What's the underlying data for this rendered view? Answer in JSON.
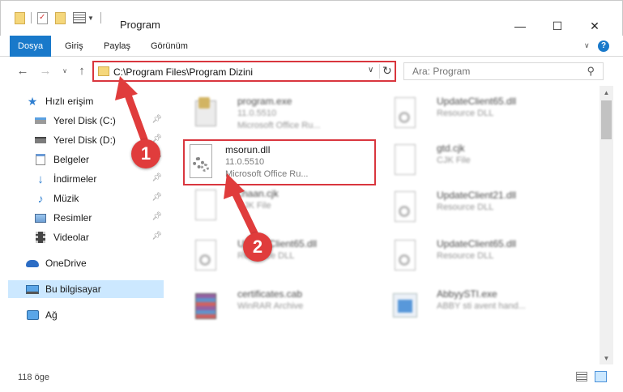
{
  "window": {
    "title": "Program",
    "minimize_glyph": "—",
    "maximize_glyph": "☐",
    "close_glyph": "✕"
  },
  "ribbon": {
    "tabs": [
      {
        "label": "Dosya",
        "active": true
      },
      {
        "label": "Giriş",
        "active": false
      },
      {
        "label": "Paylaş",
        "active": false
      },
      {
        "label": "Görünüm",
        "active": false
      }
    ]
  },
  "address": {
    "path": "C:\\Program Files\\Program Dizini"
  },
  "search": {
    "placeholder": "Ara: Program"
  },
  "sidebar": {
    "items": [
      {
        "label": "Hızlı erişim",
        "icon": "star-icon",
        "pinned": false
      },
      {
        "label": "Yerel Disk (C:)",
        "icon": "drive-icon",
        "pinned": true
      },
      {
        "label": "Yerel Disk (D:)",
        "icon": "drive-icon",
        "pinned": true
      },
      {
        "label": "Belgeler",
        "icon": "documents-icon",
        "pinned": true
      },
      {
        "label": "İndirmeler",
        "icon": "download-icon",
        "pinned": true
      },
      {
        "label": "Müzik",
        "icon": "music-icon",
        "pinned": true
      },
      {
        "label": "Resimler",
        "icon": "pictures-icon",
        "pinned": true
      },
      {
        "label": "Videolar",
        "icon": "video-icon",
        "pinned": true
      },
      {
        "label": "OneDrive",
        "icon": "cloud-icon",
        "pinned": false
      },
      {
        "label": "Bu bilgisayar",
        "icon": "computer-icon",
        "pinned": false,
        "selected": true
      },
      {
        "label": "Ağ",
        "icon": "network-icon",
        "pinned": false
      }
    ]
  },
  "files": [
    {
      "name": "program.exe",
      "version": "11.0.5510",
      "desc": "Microsoft Office Ru...",
      "icon": "exe-icon"
    },
    {
      "name": "UpdateClient65.dll",
      "version": "",
      "desc": "Resource DLL",
      "icon": "dll-icon"
    },
    {
      "name": "msorun.dll",
      "version": "11.0.5510",
      "desc": "Microsoft Office Ru...",
      "icon": "gear-file-icon"
    },
    {
      "name": "gtd.cjk",
      "version": "",
      "desc": "CJK File",
      "icon": "blank-file-icon"
    },
    {
      "name": "chaan.cjk",
      "version": "",
      "desc": "CJK File",
      "icon": "blank-file-icon"
    },
    {
      "name": "UpdateClient21.dll",
      "version": "",
      "desc": "Resource DLL",
      "icon": "dll-icon"
    },
    {
      "name": "UpdateClient65.dll",
      "version": "",
      "desc": "Resource DLL",
      "icon": "dll-icon"
    },
    {
      "name": "UpdateClient65.dll",
      "version": "",
      "desc": "Resource DLL",
      "icon": "dll-icon"
    },
    {
      "name": "certificates.cab",
      "version": "",
      "desc": "WinRAR Archive",
      "icon": "archive-icon"
    },
    {
      "name": "AbbyySTI.exe",
      "version": "",
      "desc": "ABBY sti avent hand...",
      "icon": "app-icon"
    }
  ],
  "status": {
    "item_count": "118 öge"
  },
  "annotations": {
    "step1": "1",
    "step2": "2"
  },
  "colors": {
    "accent": "#1979ca",
    "highlight_red": "#d9363e",
    "selected_bg": "#cce8ff"
  }
}
